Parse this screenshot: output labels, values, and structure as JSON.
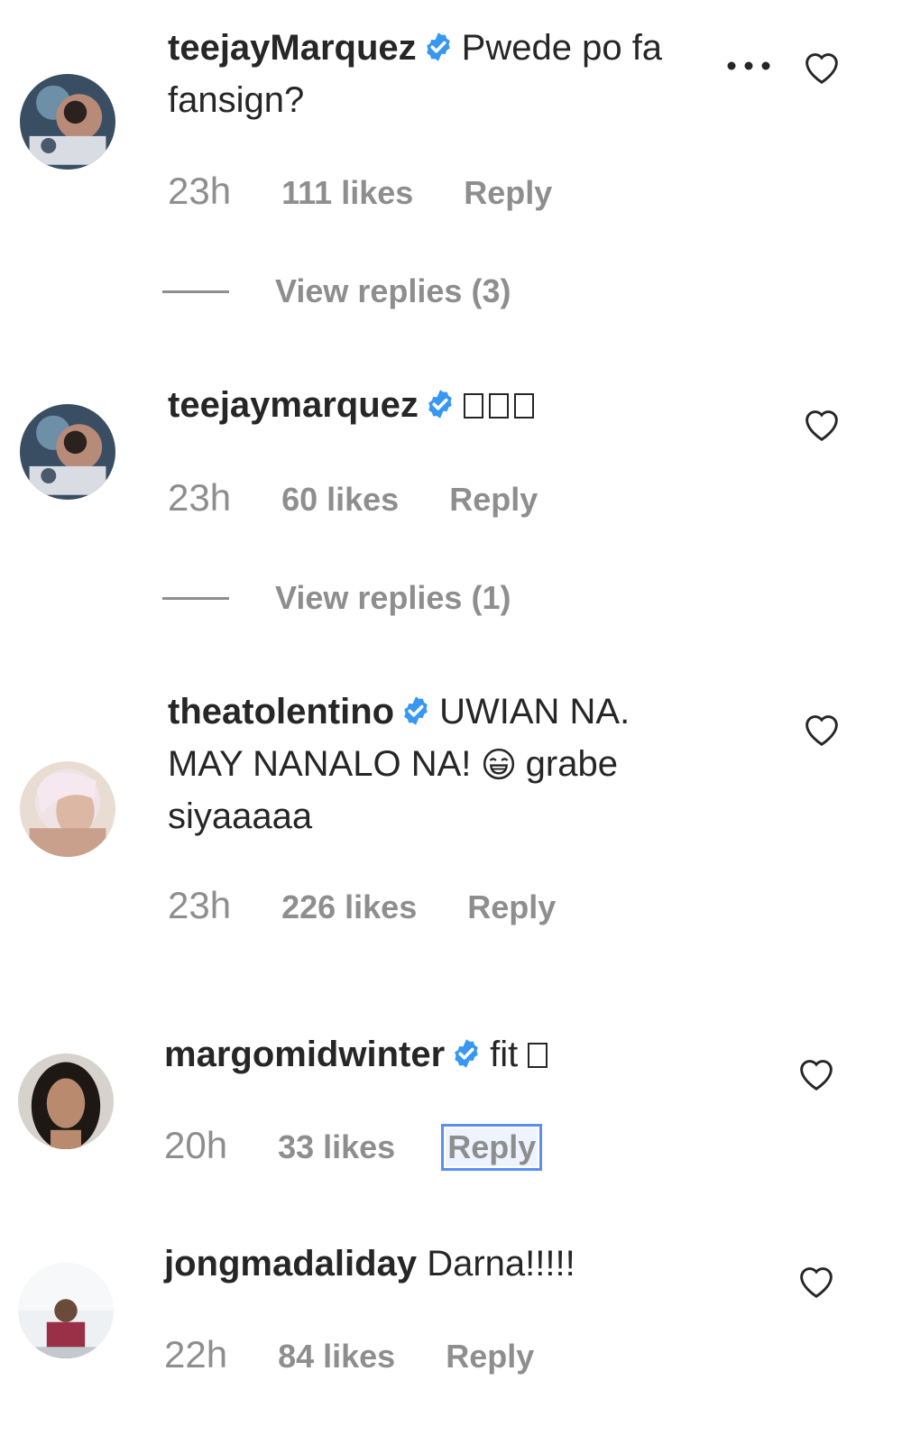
{
  "comments": [
    {
      "username": "teejayMarquez",
      "text": "Pwede po fa",
      "text_line2": "fansign?",
      "time": "23h",
      "likes": "111 likes",
      "reply": "Reply",
      "view_replies": "View replies (3)"
    },
    {
      "username": "teejaymarquez",
      "text": "",
      "time": "23h",
      "likes": "60 likes",
      "reply": "Reply",
      "view_replies": "View replies (1)"
    },
    {
      "username": "theatolentino",
      "text": "UWIAN NA.",
      "text_line2a": "MAY NANALO NA!",
      "text_line2b": "grabe",
      "text_line3": "siyaaaaa",
      "time": "23h",
      "likes": "226 likes",
      "reply": "Reply"
    },
    {
      "username": "margomidwinter",
      "text": "fit",
      "time": "20h",
      "likes": "33 likes",
      "reply": "Reply"
    },
    {
      "username": "jongmadaliday",
      "text": "Darna!!!!!",
      "time": "22h",
      "likes": "84 likes",
      "reply": "Reply"
    }
  ],
  "icons": {
    "verified": "verified-badge-icon",
    "heart": "heart-outline-icon",
    "more": "more-options-icon",
    "emoji": "laughing-emoji-icon"
  },
  "colors": {
    "text": "#262626",
    "secondary": "#8e8e8e",
    "verified_blue": "#3897f0",
    "focus_outline": "#5b8ef0"
  }
}
